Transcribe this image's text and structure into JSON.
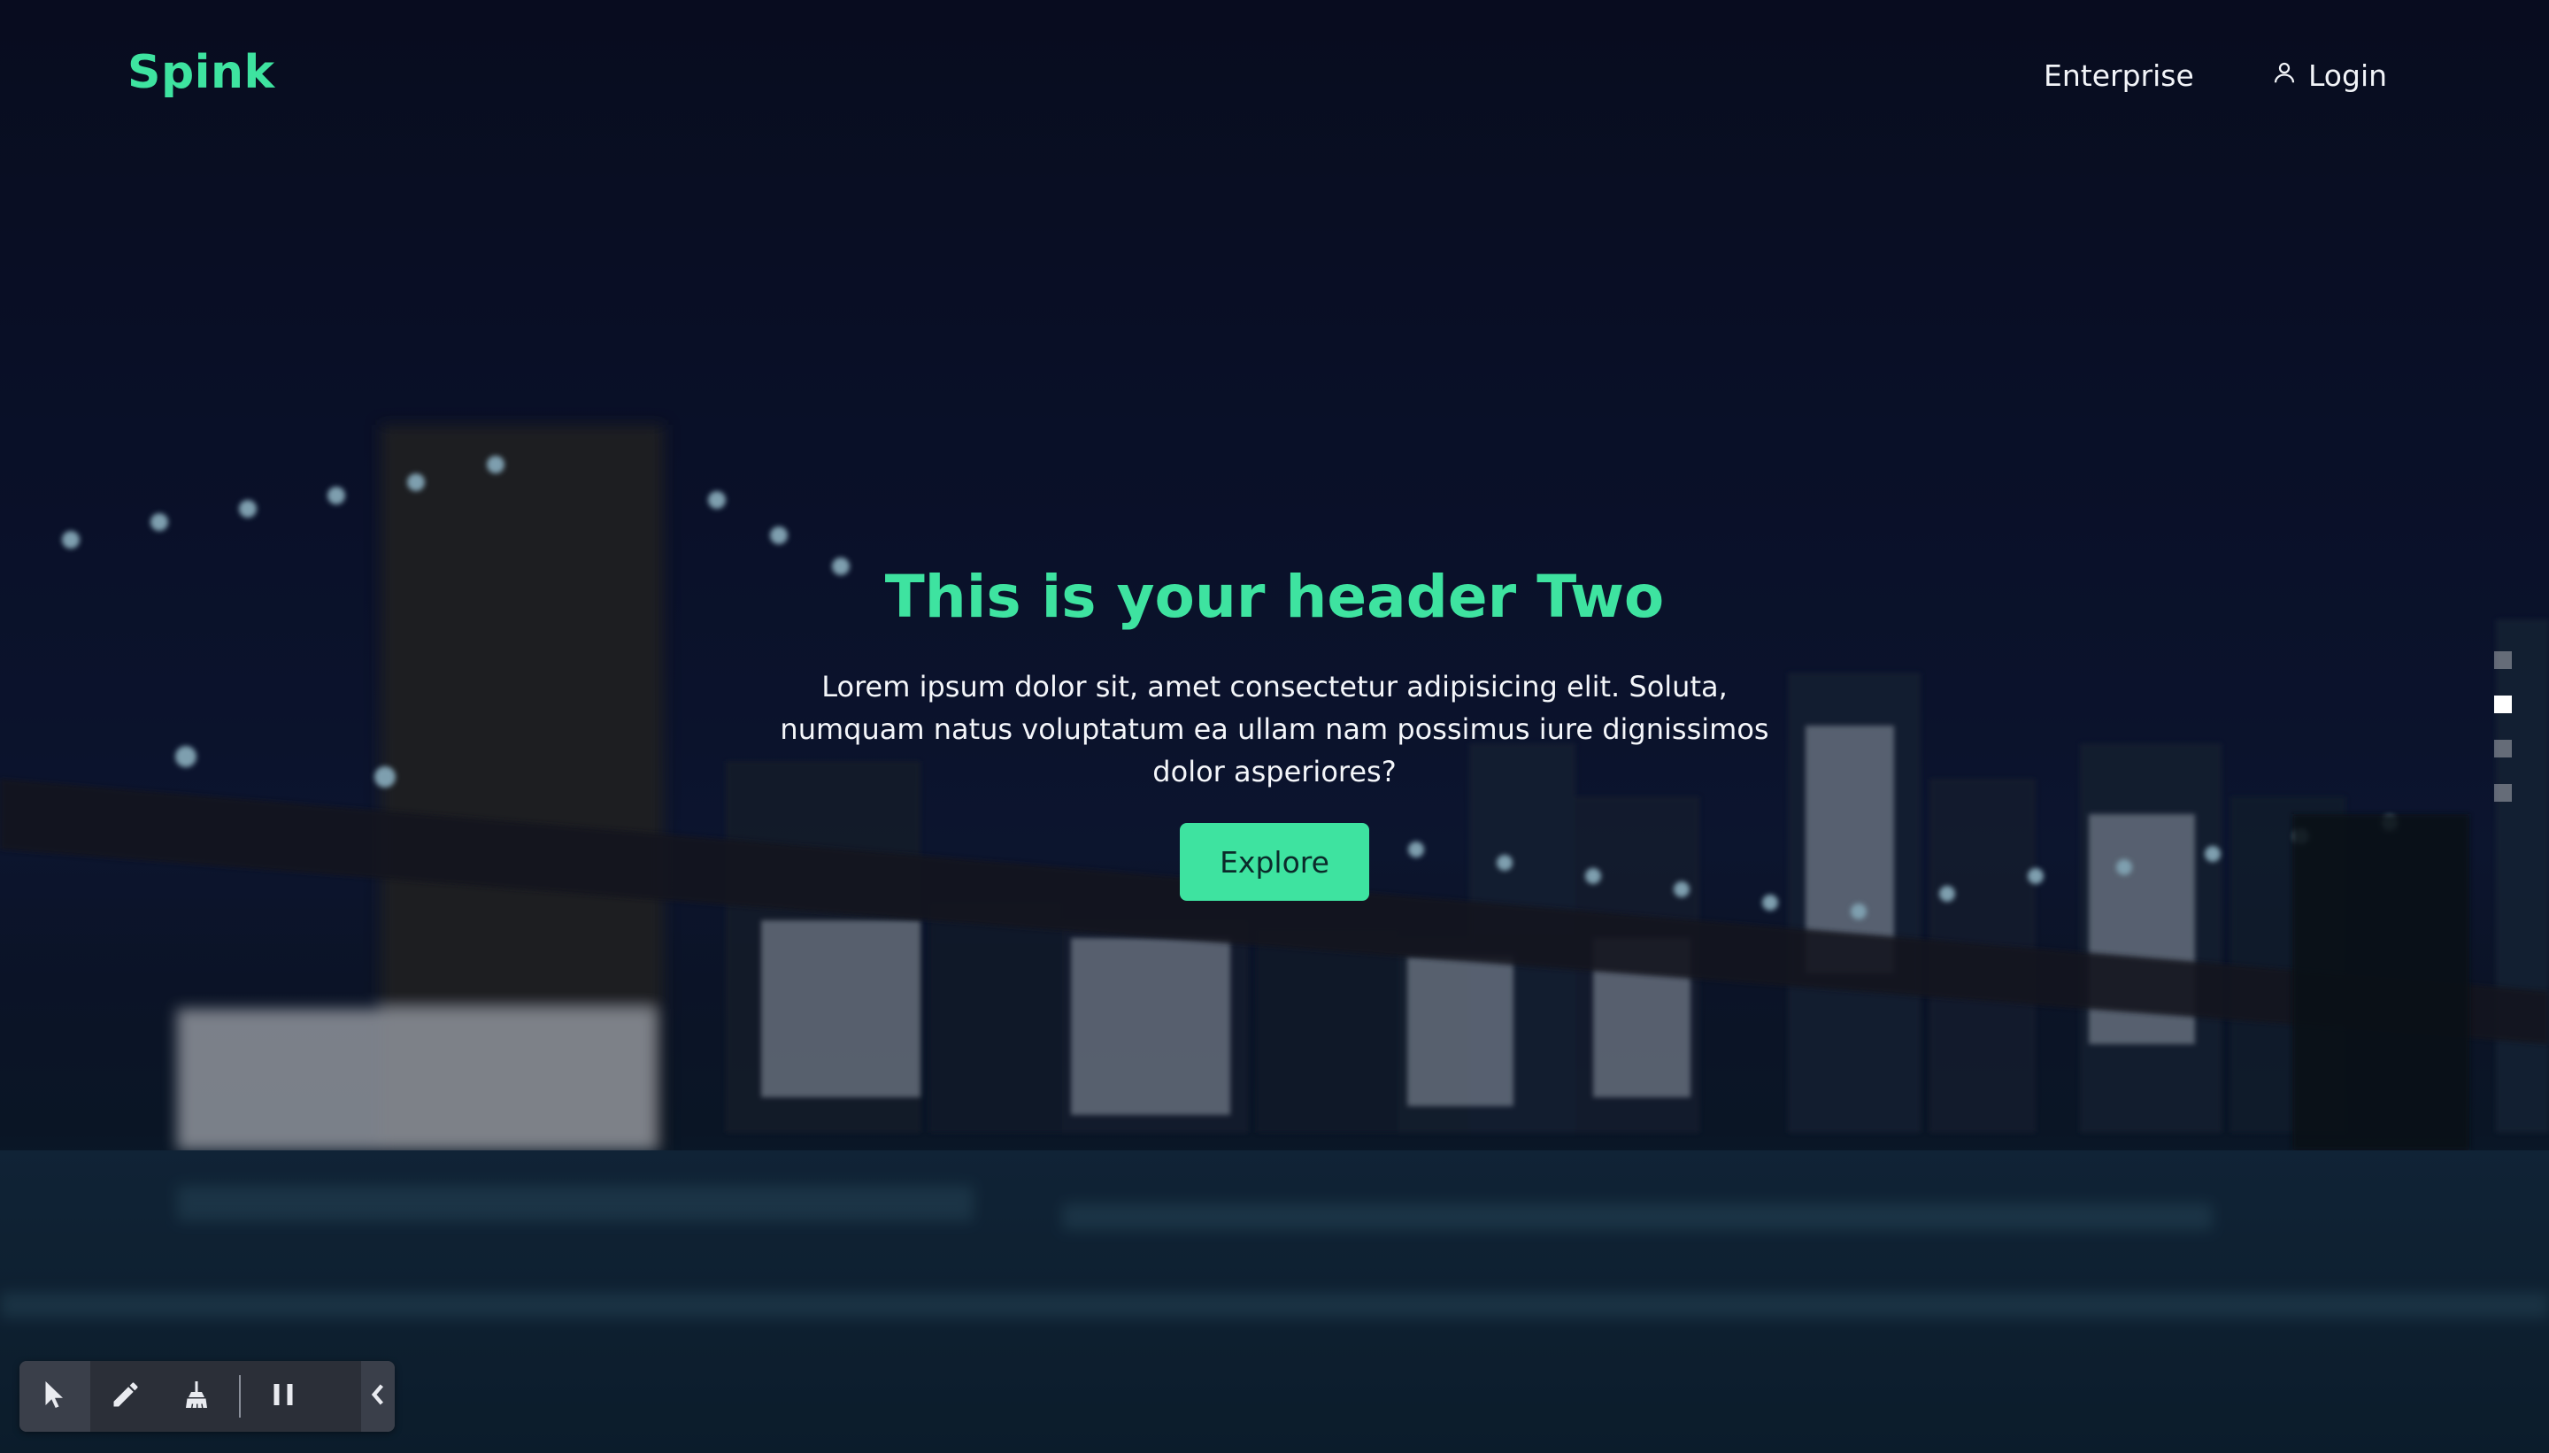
{
  "brand": {
    "name": "Spink",
    "color": "#3ee3a0"
  },
  "nav": {
    "enterprise_label": "Enterprise",
    "login_label": "Login",
    "login_icon": "user-icon"
  },
  "hero": {
    "title": "This is your header Two",
    "text": "Lorem ipsum dolor sit, amet consectetur adipisicing elit. Soluta, numquam natus voluptatum ea ullam nam possimus iure dignissimos dolor asperiores?",
    "button_label": "Explore"
  },
  "slider": {
    "count": 4,
    "active_index": 1
  },
  "toolbar": {
    "tools": [
      "cursor-icon",
      "pencil-icon",
      "broom-icon",
      "pause-icon"
    ],
    "collapse_icon": "chevron-left-icon"
  },
  "colors": {
    "accent": "#3ee3a0",
    "toolbar_bg": "#2b2f38"
  }
}
